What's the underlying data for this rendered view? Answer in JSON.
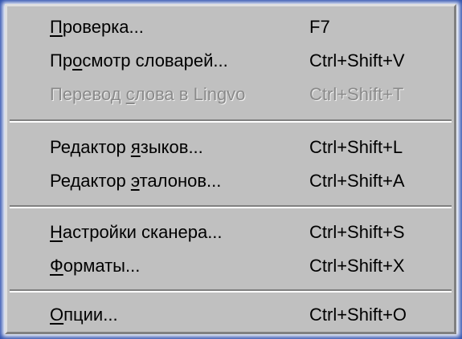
{
  "menu": {
    "items": [
      {
        "pre": "",
        "key": "П",
        "post": "роверка...",
        "shortcut": "F7",
        "enabled": true
      },
      {
        "pre": "Пр",
        "key": "о",
        "post": "смотр словарей...",
        "shortcut": "Ctrl+Shift+V",
        "enabled": true
      },
      {
        "pre": "Перевод ",
        "key": "с",
        "post": "лова в Lingvo",
        "shortcut": "Ctrl+Shift+T",
        "enabled": false
      },
      {
        "pre": "Редактор ",
        "key": "я",
        "post": "зыков...",
        "shortcut": "Ctrl+Shift+L",
        "enabled": true
      },
      {
        "pre": "Редактор ",
        "key": "э",
        "post": "талонов...",
        "shortcut": "Ctrl+Shift+A",
        "enabled": true
      },
      {
        "pre": "",
        "key": "Н",
        "post": "астройки сканера...",
        "shortcut": "Ctrl+Shift+S",
        "enabled": true
      },
      {
        "pre": "",
        "key": "Ф",
        "post": "орматы...",
        "shortcut": "Ctrl+Shift+X",
        "enabled": true
      },
      {
        "pre": "",
        "key": "О",
        "post": "пции...",
        "shortcut": "Ctrl+Shift+O",
        "enabled": true
      }
    ]
  }
}
